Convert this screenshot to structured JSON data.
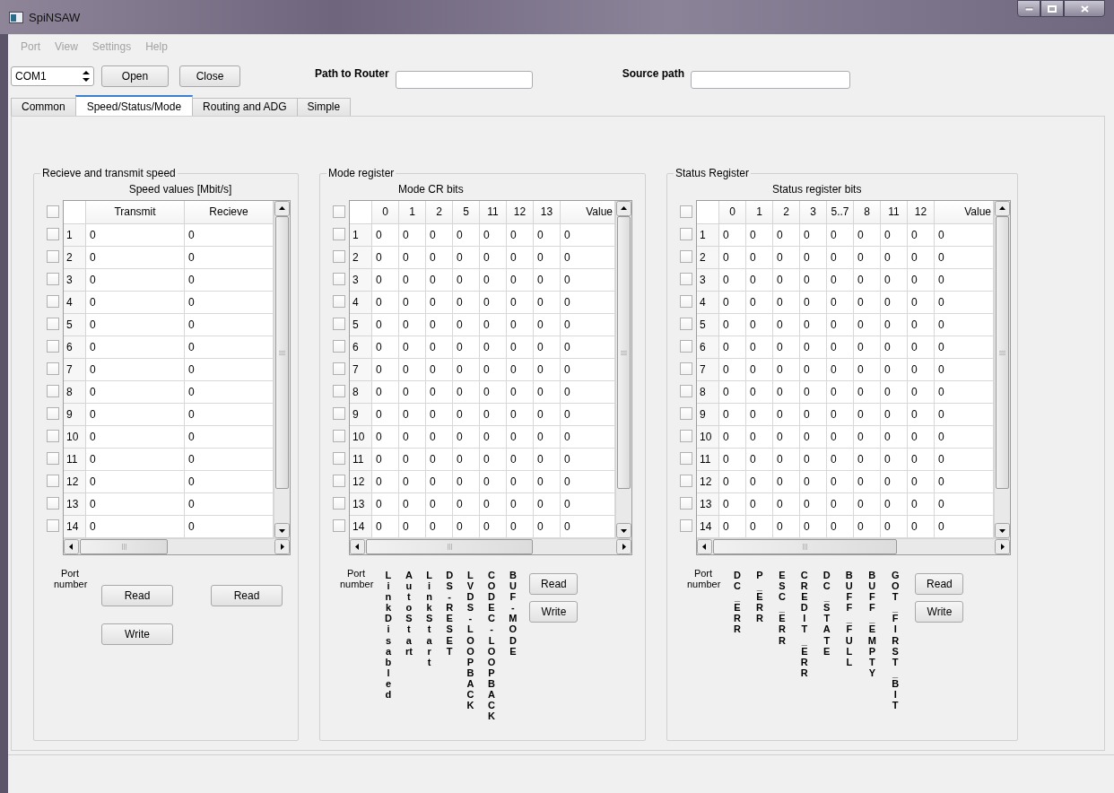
{
  "window": {
    "title": "SpiNSAW"
  },
  "menu": [
    {
      "label": "Port",
      "disabled": true
    },
    {
      "label": "View",
      "disabled": true
    },
    {
      "label": "Settings",
      "disabled": true
    },
    {
      "label": "Help",
      "disabled": true
    }
  ],
  "toolbar": {
    "port_select": {
      "value": "COM1"
    },
    "buttons": [
      "Open",
      "Close"
    ],
    "fields": [
      {
        "label": "Path to Router"
      },
      {
        "label": "Source path"
      }
    ]
  },
  "tabs": [
    {
      "label": "Common",
      "selected": false
    },
    {
      "label": "Speed/Status/Mode",
      "selected": true
    },
    {
      "label": "Routing and ADG",
      "selected": false
    },
    {
      "label": "Simple",
      "selected": false
    }
  ],
  "groups": [
    {
      "kind": "speed",
      "title": "Recieve and transmit speed",
      "caption": "Speed values [Mbit/s]",
      "columns": [
        "Transmit",
        "Recieve"
      ],
      "header_checked": false,
      "rows": [
        {
          "number": "1",
          "checked": false,
          "cells": [
            "0",
            "0"
          ]
        },
        {
          "number": "2",
          "checked": false,
          "cells": [
            "0",
            "0"
          ]
        },
        {
          "number": "3",
          "checked": false,
          "cells": [
            "0",
            "0"
          ]
        },
        {
          "number": "4",
          "checked": false,
          "cells": [
            "0",
            "0"
          ]
        },
        {
          "number": "5",
          "checked": false,
          "cells": [
            "0",
            "0"
          ]
        },
        {
          "number": "6",
          "checked": false,
          "cells": [
            "0",
            "0"
          ]
        },
        {
          "number": "7",
          "checked": false,
          "cells": [
            "0",
            "0"
          ]
        },
        {
          "number": "8",
          "checked": false,
          "cells": [
            "0",
            "0"
          ]
        },
        {
          "number": "9",
          "checked": false,
          "cells": [
            "0",
            "0"
          ]
        },
        {
          "number": "10",
          "checked": false,
          "cells": [
            "0",
            "0"
          ]
        },
        {
          "number": "11",
          "checked": false,
          "cells": [
            "0",
            "0"
          ]
        },
        {
          "number": "12",
          "checked": false,
          "cells": [
            "0",
            "0"
          ]
        },
        {
          "number": "13",
          "checked": false,
          "cells": [
            "0",
            "0"
          ]
        },
        {
          "number": "14",
          "checked": false,
          "cells": [
            "0",
            "0"
          ]
        }
      ],
      "port_label": "Port number",
      "buttons": [
        "Read",
        "Read",
        "Write"
      ]
    },
    {
      "kind": "register",
      "title": "Mode register",
      "caption": "Mode CR bits",
      "columns": [
        "0",
        "1",
        "2",
        "5",
        "11",
        "12",
        "13",
        "Value"
      ],
      "header_checked": false,
      "rows": [
        {
          "number": "1",
          "checked": false,
          "cells": [
            "0",
            "0",
            "0",
            "0",
            "0",
            "0",
            "0",
            "0"
          ]
        },
        {
          "number": "2",
          "checked": false,
          "cells": [
            "0",
            "0",
            "0",
            "0",
            "0",
            "0",
            "0",
            "0"
          ]
        },
        {
          "number": "3",
          "checked": false,
          "cells": [
            "0",
            "0",
            "0",
            "0",
            "0",
            "0",
            "0",
            "0"
          ]
        },
        {
          "number": "4",
          "checked": false,
          "cells": [
            "0",
            "0",
            "0",
            "0",
            "0",
            "0",
            "0",
            "0"
          ]
        },
        {
          "number": "5",
          "checked": false,
          "cells": [
            "0",
            "0",
            "0",
            "0",
            "0",
            "0",
            "0",
            "0"
          ]
        },
        {
          "number": "6",
          "checked": false,
          "cells": [
            "0",
            "0",
            "0",
            "0",
            "0",
            "0",
            "0",
            "0"
          ]
        },
        {
          "number": "7",
          "checked": false,
          "cells": [
            "0",
            "0",
            "0",
            "0",
            "0",
            "0",
            "0",
            "0"
          ]
        },
        {
          "number": "8",
          "checked": false,
          "cells": [
            "0",
            "0",
            "0",
            "0",
            "0",
            "0",
            "0",
            "0"
          ]
        },
        {
          "number": "9",
          "checked": false,
          "cells": [
            "0",
            "0",
            "0",
            "0",
            "0",
            "0",
            "0",
            "0"
          ]
        },
        {
          "number": "10",
          "checked": false,
          "cells": [
            "0",
            "0",
            "0",
            "0",
            "0",
            "0",
            "0",
            "0"
          ]
        },
        {
          "number": "11",
          "checked": false,
          "cells": [
            "0",
            "0",
            "0",
            "0",
            "0",
            "0",
            "0",
            "0"
          ]
        },
        {
          "number": "12",
          "checked": false,
          "cells": [
            "0",
            "0",
            "0",
            "0",
            "0",
            "0",
            "0",
            "0"
          ]
        },
        {
          "number": "13",
          "checked": false,
          "cells": [
            "0",
            "0",
            "0",
            "0",
            "0",
            "0",
            "0",
            "0"
          ]
        },
        {
          "number": "14",
          "checked": false,
          "cells": [
            "0",
            "0",
            "0",
            "0",
            "0",
            "0",
            "0",
            "0"
          ]
        }
      ],
      "port_label": "Port number",
      "bit_labels": [
        "LinkDisabled",
        "AutoStart",
        "LinkStart",
        "DS-RESET",
        "LVDS-LOOPBACK",
        "CODEC-LOOPBACK",
        "BUF-MODE"
      ],
      "buttons": [
        "Read",
        "Write"
      ]
    },
    {
      "kind": "register",
      "title": "Status Register",
      "caption": "Status register bits",
      "columns": [
        "0",
        "1",
        "2",
        "3",
        "5..7",
        "8",
        "11",
        "12",
        "Value"
      ],
      "header_checked": false,
      "rows": [
        {
          "number": "1",
          "checked": false,
          "cells": [
            "0",
            "0",
            "0",
            "0",
            "0",
            "0",
            "0",
            "0",
            "0"
          ]
        },
        {
          "number": "2",
          "checked": false,
          "cells": [
            "0",
            "0",
            "0",
            "0",
            "0",
            "0",
            "0",
            "0",
            "0"
          ]
        },
        {
          "number": "3",
          "checked": false,
          "cells": [
            "0",
            "0",
            "0",
            "0",
            "0",
            "0",
            "0",
            "0",
            "0"
          ]
        },
        {
          "number": "4",
          "checked": false,
          "cells": [
            "0",
            "0",
            "0",
            "0",
            "0",
            "0",
            "0",
            "0",
            "0"
          ]
        },
        {
          "number": "5",
          "checked": false,
          "cells": [
            "0",
            "0",
            "0",
            "0",
            "0",
            "0",
            "0",
            "0",
            "0"
          ]
        },
        {
          "number": "6",
          "checked": false,
          "cells": [
            "0",
            "0",
            "0",
            "0",
            "0",
            "0",
            "0",
            "0",
            "0"
          ]
        },
        {
          "number": "7",
          "checked": false,
          "cells": [
            "0",
            "0",
            "0",
            "0",
            "0",
            "0",
            "0",
            "0",
            "0"
          ]
        },
        {
          "number": "8",
          "checked": false,
          "cells": [
            "0",
            "0",
            "0",
            "0",
            "0",
            "0",
            "0",
            "0",
            "0"
          ]
        },
        {
          "number": "9",
          "checked": false,
          "cells": [
            "0",
            "0",
            "0",
            "0",
            "0",
            "0",
            "0",
            "0",
            "0"
          ]
        },
        {
          "number": "10",
          "checked": false,
          "cells": [
            "0",
            "0",
            "0",
            "0",
            "0",
            "0",
            "0",
            "0",
            "0"
          ]
        },
        {
          "number": "11",
          "checked": false,
          "cells": [
            "0",
            "0",
            "0",
            "0",
            "0",
            "0",
            "0",
            "0",
            "0"
          ]
        },
        {
          "number": "12",
          "checked": false,
          "cells": [
            "0",
            "0",
            "0",
            "0",
            "0",
            "0",
            "0",
            "0",
            "0"
          ]
        },
        {
          "number": "13",
          "checked": false,
          "cells": [
            "0",
            "0",
            "0",
            "0",
            "0",
            "0",
            "0",
            "0",
            "0"
          ]
        },
        {
          "number": "14",
          "checked": false,
          "cells": [
            "0",
            "0",
            "0",
            "0",
            "0",
            "0",
            "0",
            "0",
            "0"
          ]
        }
      ],
      "port_label": "Port number",
      "bit_labels": [
        "DC_ERR",
        "P_ERR",
        "ESC_ERR",
        "CREDIT_ERR",
        "DC_STATE",
        "BUFF_FULL",
        "BUFF_EMPTY",
        "GOT_FIRST_BIT"
      ],
      "buttons": [
        "Read",
        "Write"
      ]
    }
  ]
}
